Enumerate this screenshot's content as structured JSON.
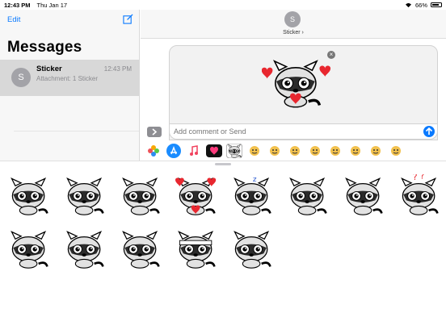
{
  "status": {
    "time": "12:43 PM",
    "date": "Thu Jan 17",
    "battery": "66%",
    "battery_level": 0.66
  },
  "sidebar": {
    "edit_label": "Edit",
    "title": "Messages",
    "conversations": [
      {
        "initial": "S",
        "name": "Sticker",
        "preview": "Attachment: 1 Sticker",
        "time": "12:43 PM"
      }
    ]
  },
  "chat": {
    "contact_initial": "S",
    "contact_name": "Sticker ›",
    "input_placeholder": "Add comment or Send",
    "remove_symbol": "×"
  },
  "app_drawer": [
    {
      "icon": "photos-icon"
    },
    {
      "icon": "app-store-icon"
    },
    {
      "icon": "music-icon"
    },
    {
      "icon": "digital-touch-icon"
    },
    {
      "icon": "raccoon-sticker-app-icon"
    },
    {
      "icon": "sticker-app-icon"
    },
    {
      "icon": "sticker-app-icon"
    },
    {
      "icon": "sticker-app-icon"
    },
    {
      "icon": "sticker-app-icon"
    },
    {
      "icon": "sticker-app-icon"
    },
    {
      "icon": "sticker-app-icon"
    },
    {
      "icon": "sticker-app-icon"
    },
    {
      "icon": "sticker-app-icon"
    }
  ],
  "stickers": [
    {
      "name": "raccoon-smile"
    },
    {
      "name": "raccoon-happy"
    },
    {
      "name": "raccoon-sad"
    },
    {
      "name": "raccoon-hearts"
    },
    {
      "name": "raccoon-sleeping"
    },
    {
      "name": "raccoon-back"
    },
    {
      "name": "raccoon-eating"
    },
    {
      "name": "raccoon-thinking"
    },
    {
      "name": "raccoon-crying"
    },
    {
      "name": "raccoon-kiss"
    },
    {
      "name": "raccoon-confused"
    },
    {
      "name": "raccoon-ninja"
    },
    {
      "name": "raccoon-cool"
    }
  ],
  "colors": {
    "accent": "#0a7aff",
    "heart": "#e8272f",
    "sidebar_selected": "#d8d8d8"
  }
}
